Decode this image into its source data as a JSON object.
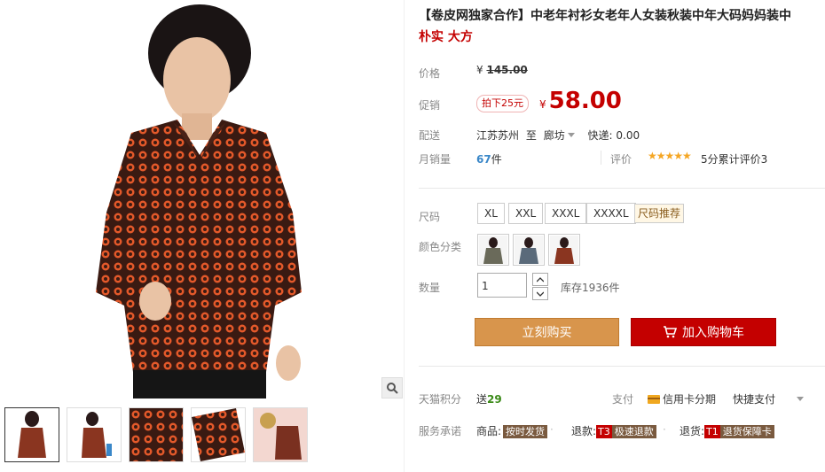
{
  "title": "【卷皮网独家合作】中老年衬衫女老年人女装秋装中年大码妈妈装中",
  "subtitle": "朴实 大方",
  "price": {
    "label": "价格",
    "currency": "¥",
    "value": "145.00"
  },
  "promo": {
    "label": "促销",
    "badge": "拍下25元",
    "currency": "¥",
    "value": "58.00"
  },
  "shipping": {
    "label": "配送",
    "from": "江苏苏州",
    "to_word": "至",
    "dest": "廊坊",
    "fee": "快递: 0.00"
  },
  "monthly": {
    "label": "月销量",
    "count": "67",
    "unit": "件"
  },
  "rating": {
    "label": "评价",
    "stars": "★★★★★",
    "text": "5分累计评价3"
  },
  "size": {
    "label": "尺码",
    "options": [
      "XL",
      "XXL",
      "XXXL",
      "XXXXL"
    ],
    "guide": "尺码推荐"
  },
  "color": {
    "label": "颜色分类"
  },
  "quantity": {
    "label": "数量",
    "value": "1",
    "stock": "库存1936件"
  },
  "buttons": {
    "buy": "立刻购买",
    "cart": "加入购物车"
  },
  "points": {
    "label": "天猫积分",
    "prefix": "送",
    "value": "29"
  },
  "payment": {
    "label": "支付",
    "card": "信用卡分期",
    "quick": "快捷支付"
  },
  "service": {
    "label": "服务承诺",
    "items": [
      {
        "prefix": "商品:",
        "code": "",
        "tag": "按时发货"
      },
      {
        "prefix": "退款:",
        "code": "T3",
        "tag": "极速退款"
      },
      {
        "prefix": "退货:",
        "code": "T1",
        "tag": "退货保障卡"
      }
    ]
  },
  "colors": {
    "accent": "#c40000",
    "buy_button": "#d8954c",
    "points": "#3b8a18",
    "star": "#f5a623",
    "link": "#3a87c8"
  }
}
